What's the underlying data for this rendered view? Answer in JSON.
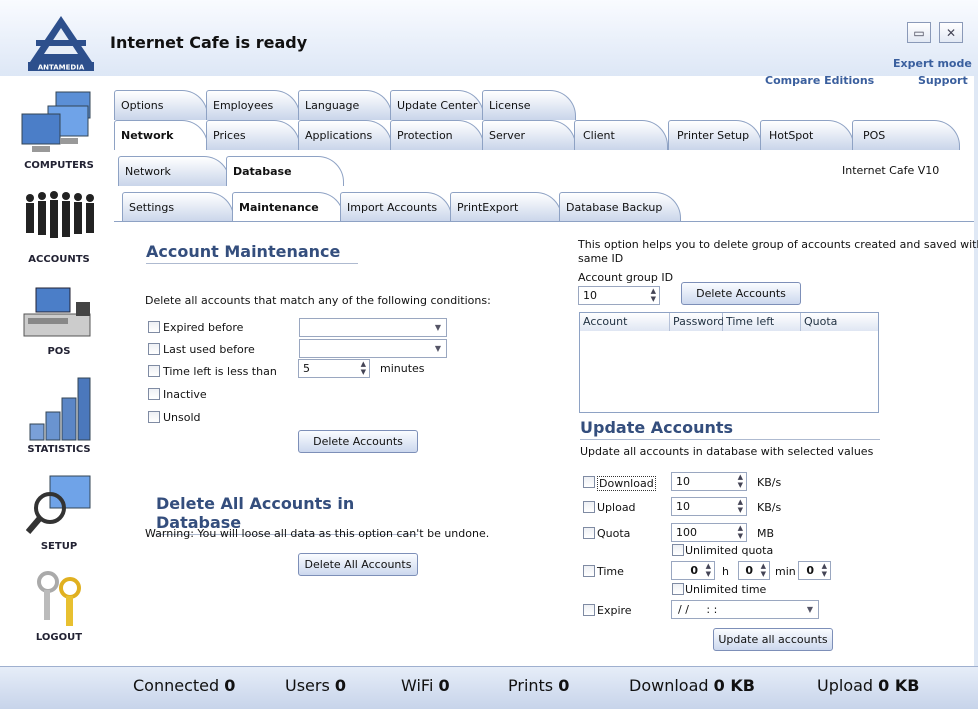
{
  "header": {
    "title": "Internet Cafe is ready",
    "logo_text": "ANTAMEDIA",
    "minimize_icon": "minimize-icon",
    "close_icon": "close-icon",
    "expert_mode": "Expert mode",
    "compare_editions": "Compare Editions",
    "support": "Support"
  },
  "sidebar": {
    "items": [
      {
        "label": "COMPUTERS"
      },
      {
        "label": "ACCOUNTS"
      },
      {
        "label": "POS"
      },
      {
        "label": "STATISTICS"
      },
      {
        "label": "SETUP"
      },
      {
        "label": "LOGOUT"
      }
    ]
  },
  "tabs_row1": [
    {
      "label": "Options"
    },
    {
      "label": "Employees"
    },
    {
      "label": "Language"
    },
    {
      "label": "Update Center"
    },
    {
      "label": "License"
    }
  ],
  "tabs_row2": [
    {
      "label": "Network"
    },
    {
      "label": "Prices"
    },
    {
      "label": "Applications"
    },
    {
      "label": "Protection"
    },
    {
      "label": "Server"
    },
    {
      "label": "Client"
    },
    {
      "label": "Printer Setup"
    },
    {
      "label": "HotSpot"
    },
    {
      "label": "POS"
    }
  ],
  "tabs_row3": [
    {
      "label": "Network"
    },
    {
      "label": "Database"
    }
  ],
  "version": "Internet Cafe V10",
  "tabs_row4": [
    {
      "label": "Settings"
    },
    {
      "label": "Maintenance"
    },
    {
      "label": "Import Accounts"
    },
    {
      "label": "PrintExport"
    },
    {
      "label": "Database Backup"
    }
  ],
  "maintenance": {
    "title": "Account Maintenance",
    "desc": "Delete all accounts that match any of the following conditions:",
    "expired_before": "Expired before",
    "last_used_before": "Last used before",
    "time_left_less": "Time left is less than",
    "time_left_value": "5",
    "minutes": "minutes",
    "inactive": "Inactive",
    "unsold": "Unsold",
    "delete_button": "Delete Accounts"
  },
  "delete_all": {
    "title": "Delete All Accounts in Database",
    "warning": "Warning: You will loose all data as this option can't be undone.",
    "button": "Delete All Accounts"
  },
  "group": {
    "desc1": "This option helps you to delete group of accounts created and saved with the",
    "desc2": "same ID",
    "label": "Account group ID",
    "value": "10",
    "button": "Delete Accounts",
    "columns": [
      "Account",
      "Password",
      "Time left",
      "Quota"
    ]
  },
  "update": {
    "title": "Update Accounts",
    "desc": "Update all accounts in database with selected values",
    "download": "Download",
    "download_value": "10",
    "download_unit": "KB/s",
    "upload": "Upload",
    "upload_value": "10",
    "upload_unit": "KB/s",
    "quota": "Quota",
    "quota_value": "100",
    "quota_unit": "MB",
    "unlimited_quota": "Unlimited quota",
    "time": "Time",
    "hours": "0",
    "h": "h",
    "minutes": "0",
    "min": "min",
    "seconds": "0",
    "unlimited_time": "Unlimited time",
    "expire": "Expire",
    "expire_value": "/ /     : :",
    "button": "Update all accounts"
  },
  "status": {
    "connected_label": "Connected",
    "connected": "0",
    "users_label": "Users",
    "users": "0",
    "wifi_label": "WiFi",
    "wifi": "0",
    "prints_label": "Prints",
    "prints": "0",
    "download_label": "Download",
    "download": "0 KB",
    "upload_label": "Upload",
    "upload": "0 KB"
  }
}
